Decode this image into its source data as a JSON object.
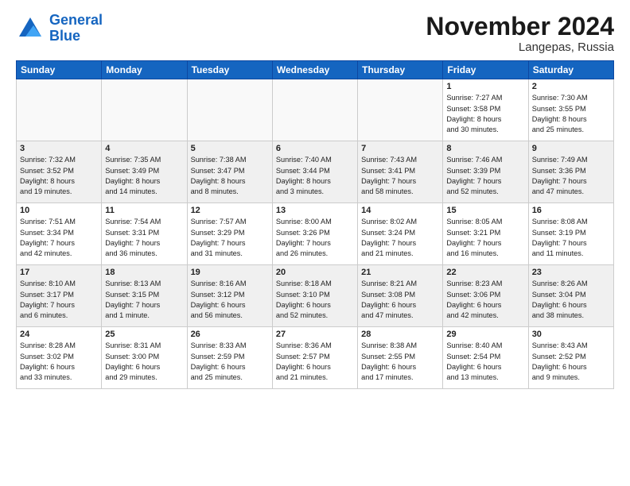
{
  "logo": {
    "line1": "General",
    "line2": "Blue"
  },
  "title": "November 2024",
  "location": "Langepas, Russia",
  "days_of_week": [
    "Sunday",
    "Monday",
    "Tuesday",
    "Wednesday",
    "Thursday",
    "Friday",
    "Saturday"
  ],
  "rows": [
    [
      {
        "day": "",
        "info": "",
        "empty": true
      },
      {
        "day": "",
        "info": "",
        "empty": true
      },
      {
        "day": "",
        "info": "",
        "empty": true
      },
      {
        "day": "",
        "info": "",
        "empty": true
      },
      {
        "day": "",
        "info": "",
        "empty": true
      },
      {
        "day": "1",
        "info": "Sunrise: 7:27 AM\nSunset: 3:58 PM\nDaylight: 8 hours\nand 30 minutes."
      },
      {
        "day": "2",
        "info": "Sunrise: 7:30 AM\nSunset: 3:55 PM\nDaylight: 8 hours\nand 25 minutes."
      }
    ],
    [
      {
        "day": "3",
        "info": "Sunrise: 7:32 AM\nSunset: 3:52 PM\nDaylight: 8 hours\nand 19 minutes.",
        "shaded": true
      },
      {
        "day": "4",
        "info": "Sunrise: 7:35 AM\nSunset: 3:49 PM\nDaylight: 8 hours\nand 14 minutes.",
        "shaded": true
      },
      {
        "day": "5",
        "info": "Sunrise: 7:38 AM\nSunset: 3:47 PM\nDaylight: 8 hours\nand 8 minutes.",
        "shaded": true
      },
      {
        "day": "6",
        "info": "Sunrise: 7:40 AM\nSunset: 3:44 PM\nDaylight: 8 hours\nand 3 minutes.",
        "shaded": true
      },
      {
        "day": "7",
        "info": "Sunrise: 7:43 AM\nSunset: 3:41 PM\nDaylight: 7 hours\nand 58 minutes.",
        "shaded": true
      },
      {
        "day": "8",
        "info": "Sunrise: 7:46 AM\nSunset: 3:39 PM\nDaylight: 7 hours\nand 52 minutes.",
        "shaded": true
      },
      {
        "day": "9",
        "info": "Sunrise: 7:49 AM\nSunset: 3:36 PM\nDaylight: 7 hours\nand 47 minutes.",
        "shaded": true
      }
    ],
    [
      {
        "day": "10",
        "info": "Sunrise: 7:51 AM\nSunset: 3:34 PM\nDaylight: 7 hours\nand 42 minutes."
      },
      {
        "day": "11",
        "info": "Sunrise: 7:54 AM\nSunset: 3:31 PM\nDaylight: 7 hours\nand 36 minutes."
      },
      {
        "day": "12",
        "info": "Sunrise: 7:57 AM\nSunset: 3:29 PM\nDaylight: 7 hours\nand 31 minutes."
      },
      {
        "day": "13",
        "info": "Sunrise: 8:00 AM\nSunset: 3:26 PM\nDaylight: 7 hours\nand 26 minutes."
      },
      {
        "day": "14",
        "info": "Sunrise: 8:02 AM\nSunset: 3:24 PM\nDaylight: 7 hours\nand 21 minutes."
      },
      {
        "day": "15",
        "info": "Sunrise: 8:05 AM\nSunset: 3:21 PM\nDaylight: 7 hours\nand 16 minutes."
      },
      {
        "day": "16",
        "info": "Sunrise: 8:08 AM\nSunset: 3:19 PM\nDaylight: 7 hours\nand 11 minutes."
      }
    ],
    [
      {
        "day": "17",
        "info": "Sunrise: 8:10 AM\nSunset: 3:17 PM\nDaylight: 7 hours\nand 6 minutes.",
        "shaded": true
      },
      {
        "day": "18",
        "info": "Sunrise: 8:13 AM\nSunset: 3:15 PM\nDaylight: 7 hours\nand 1 minute.",
        "shaded": true
      },
      {
        "day": "19",
        "info": "Sunrise: 8:16 AM\nSunset: 3:12 PM\nDaylight: 6 hours\nand 56 minutes.",
        "shaded": true
      },
      {
        "day": "20",
        "info": "Sunrise: 8:18 AM\nSunset: 3:10 PM\nDaylight: 6 hours\nand 52 minutes.",
        "shaded": true
      },
      {
        "day": "21",
        "info": "Sunrise: 8:21 AM\nSunset: 3:08 PM\nDaylight: 6 hours\nand 47 minutes.",
        "shaded": true
      },
      {
        "day": "22",
        "info": "Sunrise: 8:23 AM\nSunset: 3:06 PM\nDaylight: 6 hours\nand 42 minutes.",
        "shaded": true
      },
      {
        "day": "23",
        "info": "Sunrise: 8:26 AM\nSunset: 3:04 PM\nDaylight: 6 hours\nand 38 minutes.",
        "shaded": true
      }
    ],
    [
      {
        "day": "24",
        "info": "Sunrise: 8:28 AM\nSunset: 3:02 PM\nDaylight: 6 hours\nand 33 minutes."
      },
      {
        "day": "25",
        "info": "Sunrise: 8:31 AM\nSunset: 3:00 PM\nDaylight: 6 hours\nand 29 minutes."
      },
      {
        "day": "26",
        "info": "Sunrise: 8:33 AM\nSunset: 2:59 PM\nDaylight: 6 hours\nand 25 minutes."
      },
      {
        "day": "27",
        "info": "Sunrise: 8:36 AM\nSunset: 2:57 PM\nDaylight: 6 hours\nand 21 minutes."
      },
      {
        "day": "28",
        "info": "Sunrise: 8:38 AM\nSunset: 2:55 PM\nDaylight: 6 hours\nand 17 minutes."
      },
      {
        "day": "29",
        "info": "Sunrise: 8:40 AM\nSunset: 2:54 PM\nDaylight: 6 hours\nand 13 minutes."
      },
      {
        "day": "30",
        "info": "Sunrise: 8:43 AM\nSunset: 2:52 PM\nDaylight: 6 hours\nand 9 minutes."
      }
    ]
  ]
}
